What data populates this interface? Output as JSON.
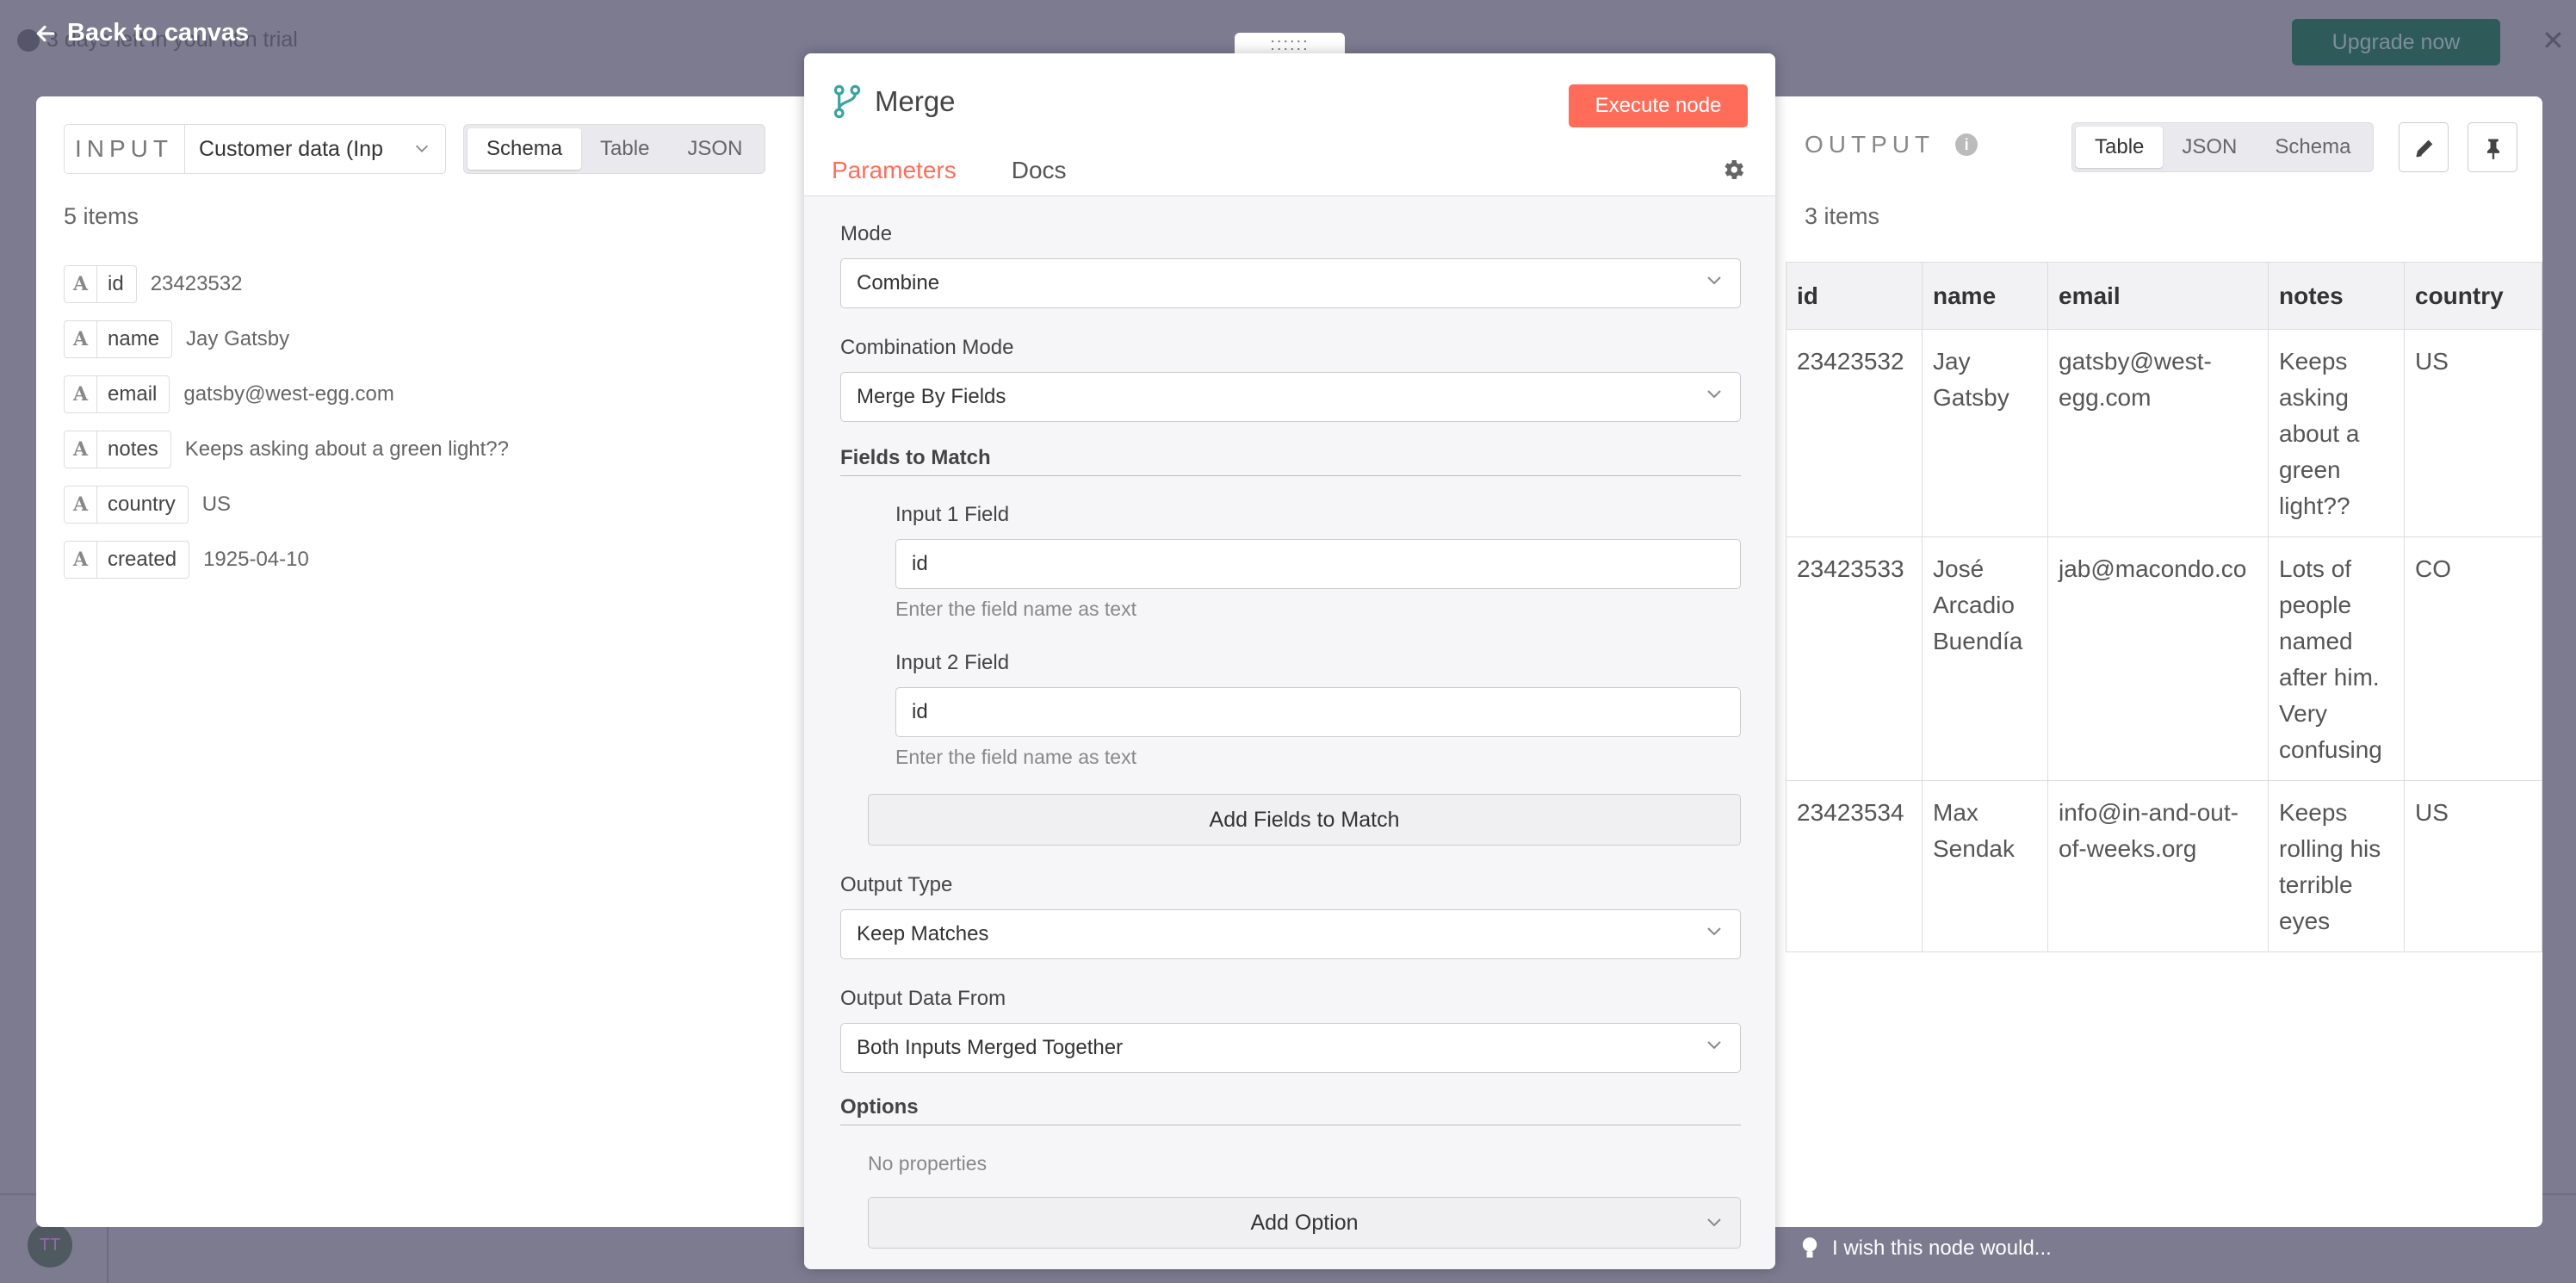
{
  "background": {
    "trial_text": "3 days left in your n8n trial",
    "upgrade_label": "Upgrade now",
    "avatar_initials": "TT"
  },
  "back_link": "Back to canvas",
  "drag_handle": "::::::",
  "node": {
    "name": "Merge",
    "execute_label": "Execute node",
    "tabs": [
      "Parameters",
      "Docs"
    ],
    "mode_label": "Mode",
    "mode_value": "Combine",
    "combination_label": "Combination Mode",
    "combination_value": "Merge By Fields",
    "fields_to_match_title": "Fields to Match",
    "input1_label": "Input 1 Field",
    "input1_value": "id",
    "input1_hint": "Enter the field name as text",
    "input2_label": "Input 2 Field",
    "input2_value": "id",
    "input2_hint": "Enter the field name as text",
    "add_fields_label": "Add Fields to Match",
    "output_type_label": "Output Type",
    "output_type_value": "Keep Matches",
    "output_data_label": "Output Data From",
    "output_data_value": "Both Inputs Merged Together",
    "options_title": "Options",
    "no_properties": "No properties",
    "add_option_label": "Add Option"
  },
  "input": {
    "label": "INPUT",
    "source_value": "Customer data (Inp",
    "views": [
      "Schema",
      "Table",
      "JSON"
    ],
    "active_view": "Schema",
    "items_count": "5 items",
    "fields": [
      {
        "key": "id",
        "value": "23423532"
      },
      {
        "key": "name",
        "value": "Jay Gatsby"
      },
      {
        "key": "email",
        "value": "gatsby@west-egg.com"
      },
      {
        "key": "notes",
        "value": "Keeps asking about a green light??"
      },
      {
        "key": "country",
        "value": "US"
      },
      {
        "key": "created",
        "value": "1925-04-10"
      }
    ]
  },
  "output": {
    "label": "OUTPUT",
    "views": [
      "Table",
      "JSON",
      "Schema"
    ],
    "active_view": "Table",
    "items_count": "3 items",
    "columns": [
      "id",
      "name",
      "email",
      "notes",
      "country"
    ],
    "rows": [
      [
        "23423532",
        "Jay Gatsby",
        "gatsby@west-egg.com",
        "Keeps asking about a green light??",
        "US"
      ],
      [
        "23423533",
        "José Arcadio Buendía",
        "jab@macondo.co",
        "Lots of people named after him. Very confusing",
        "CO"
      ],
      [
        "23423534",
        "Max Sendak",
        "info@in-and-out-of-weeks.org",
        "Keeps rolling his terrible eyes",
        "US"
      ]
    ]
  },
  "feedback": "I wish this node would...",
  "colors": {
    "accent": "#ff6d5a",
    "overlay": "#7c7b90",
    "merge_icon": "#3ca3a0"
  }
}
